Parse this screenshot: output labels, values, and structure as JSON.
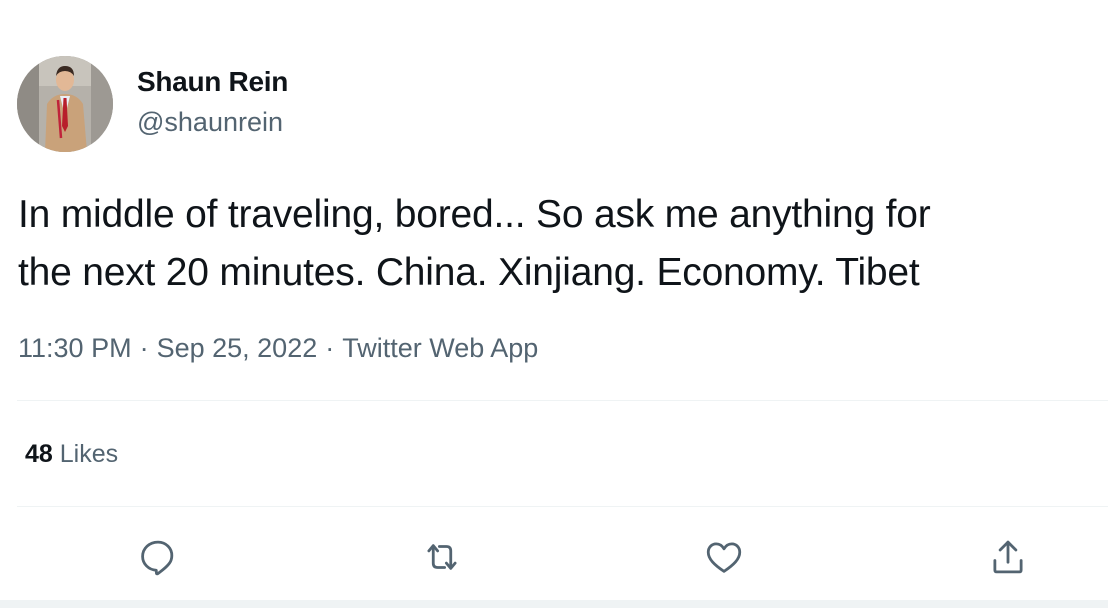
{
  "author": {
    "display_name": "Shaun Rein",
    "handle": "@shaunrein"
  },
  "tweet": {
    "text": "In middle of traveling, bored... So ask me anything for\nthe next 20 minutes. China. Xinjiang. Economy. Tibet",
    "time": "11:30 PM",
    "date": "Sep 25, 2022",
    "source": "Twitter Web App",
    "separator": "·"
  },
  "stats": {
    "likes_count": "48",
    "likes_label": "Likes"
  },
  "actions": [
    "reply-icon",
    "retweet-icon",
    "like-icon",
    "share-icon"
  ],
  "colors": {
    "text_primary": "#0f1419",
    "text_secondary": "#536471",
    "divider": "#eff3f4"
  }
}
